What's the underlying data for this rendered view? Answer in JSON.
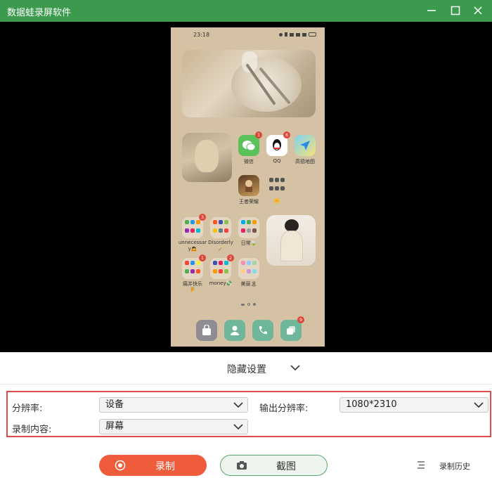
{
  "window": {
    "title": "数据蛙录屏软件"
  },
  "phone": {
    "time": "23:18",
    "apps": {
      "wechat": {
        "label": "微信",
        "badge": "1"
      },
      "qq": {
        "label": "QQ",
        "badge": "6"
      },
      "amap": {
        "label": "高德地图"
      },
      "honor": {
        "label": "王者荣耀"
      },
      "folder_blank": {
        "label": "🌼"
      },
      "unnecessary": {
        "label_line1": "unnecessar",
        "label_line2": "y🙇",
        "badge": "3"
      },
      "disorderly": {
        "label": "Disorderly",
        "label_line2": "🪄"
      },
      "daily": {
        "label": "日常🍃"
      },
      "happy": {
        "label": "痛并快乐",
        "label_line2": "🦻",
        "badge": "1"
      },
      "money": {
        "label": "money💸",
        "badge": "2"
      },
      "beauty": {
        "label": "美丽🏝"
      },
      "dock_badge": "9"
    }
  },
  "collapse": {
    "label": "隐藏设置"
  },
  "settings": {
    "resolution_label": "分辨率:",
    "resolution_value": "设备",
    "output_resolution_label": "输出分辨率:",
    "output_resolution_value": "1080*2310",
    "content_label": "录制内容:",
    "content_value": "屏幕"
  },
  "actions": {
    "record_label": "录制",
    "screenshot_label": "截图",
    "history_label": "录制历史"
  },
  "colors": {
    "titlebar": "#3c9a4f",
    "record_button": "#ee5c3c",
    "settings_border": "#e04a4a"
  }
}
